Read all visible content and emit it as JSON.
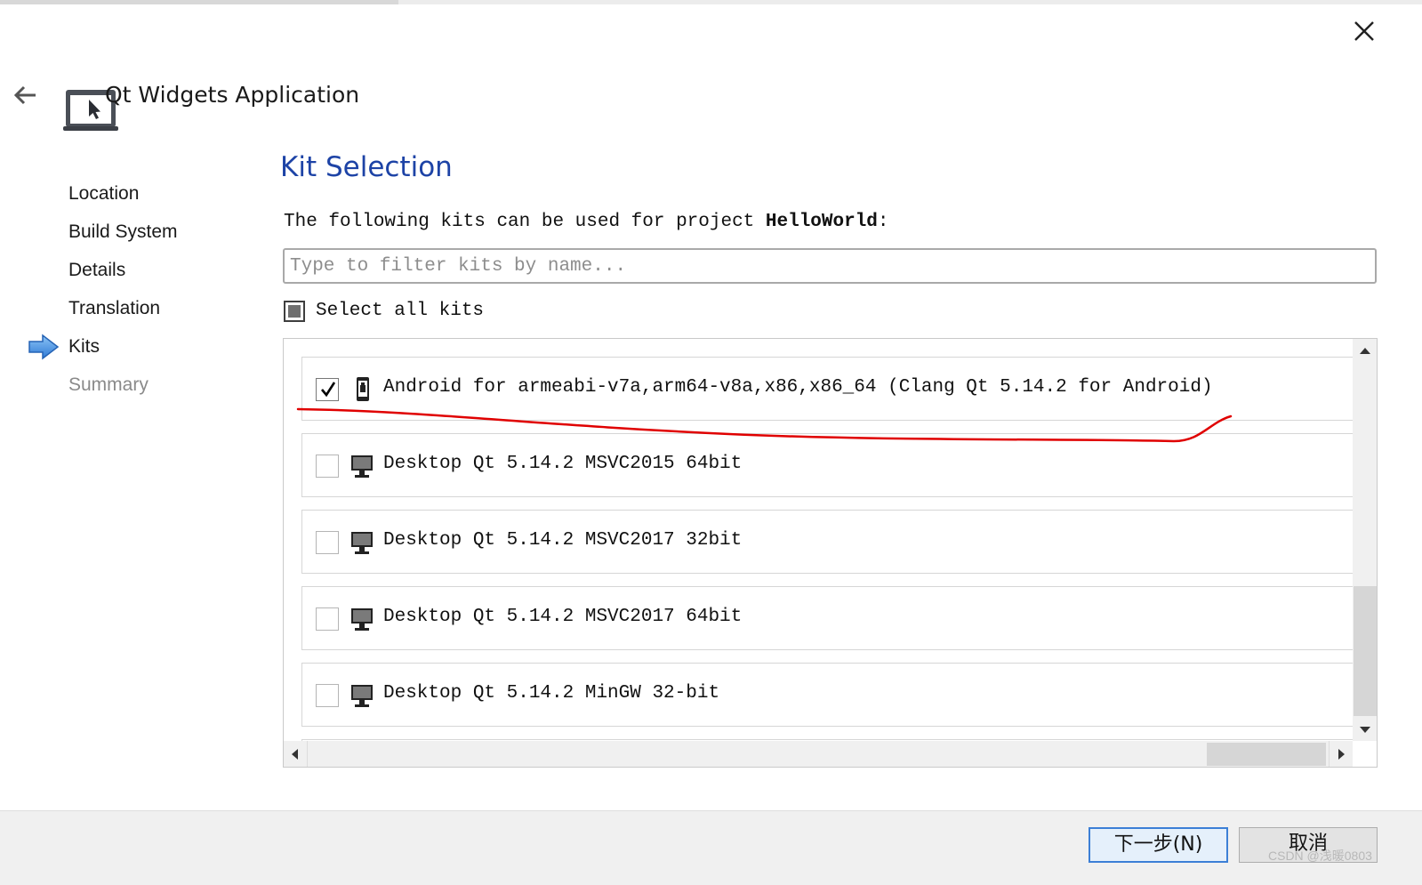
{
  "wizard": {
    "title": "Qt Widgets Application",
    "progress_percent": 28
  },
  "icons": {
    "close": "close-icon",
    "back": "back-arrow-icon",
    "app": "application-window-icon",
    "current_step": "current-step-arrow-icon",
    "android": "android-device-icon",
    "desktop": "desktop-monitor-icon"
  },
  "steps": [
    {
      "label": "Location",
      "state": "done"
    },
    {
      "label": "Build System",
      "state": "done"
    },
    {
      "label": "Details",
      "state": "done"
    },
    {
      "label": "Translation",
      "state": "done"
    },
    {
      "label": "Kits",
      "state": "current"
    },
    {
      "label": "Summary",
      "state": "pending"
    }
  ],
  "page": {
    "heading": "Kit Selection",
    "intro_prefix": "The following kits can be used for project ",
    "project_name": "HelloWorld",
    "intro_suffix": ":",
    "filter_placeholder": "Type to filter kits by name...",
    "filter_value": "",
    "select_all_label": "Select all kits",
    "select_all_state": "partial"
  },
  "kits": [
    {
      "label": "Android for armeabi-v7a,arm64-v8a,x86,x86_64 (Clang Qt 5.14.2 for Android)",
      "checked": true,
      "icon": "android-device-icon"
    },
    {
      "label": "Desktop Qt 5.14.2 MSVC2015 64bit",
      "checked": false,
      "icon": "desktop-monitor-icon"
    },
    {
      "label": "Desktop Qt 5.14.2 MSVC2017 32bit",
      "checked": false,
      "icon": "desktop-monitor-icon"
    },
    {
      "label": "Desktop Qt 5.14.2 MSVC2017 64bit",
      "checked": false,
      "icon": "desktop-monitor-icon"
    },
    {
      "label": "Desktop Qt 5.14.2 MinGW 32-bit",
      "checked": false,
      "icon": "desktop-monitor-icon"
    }
  ],
  "footer": {
    "next_label": "下一步(N)",
    "cancel_label": "取消"
  },
  "watermark": "CSDN @浅暖0803",
  "colors": {
    "heading": "#1d43a6",
    "annotation": "#e00000",
    "next_border": "#3c7fd6"
  }
}
